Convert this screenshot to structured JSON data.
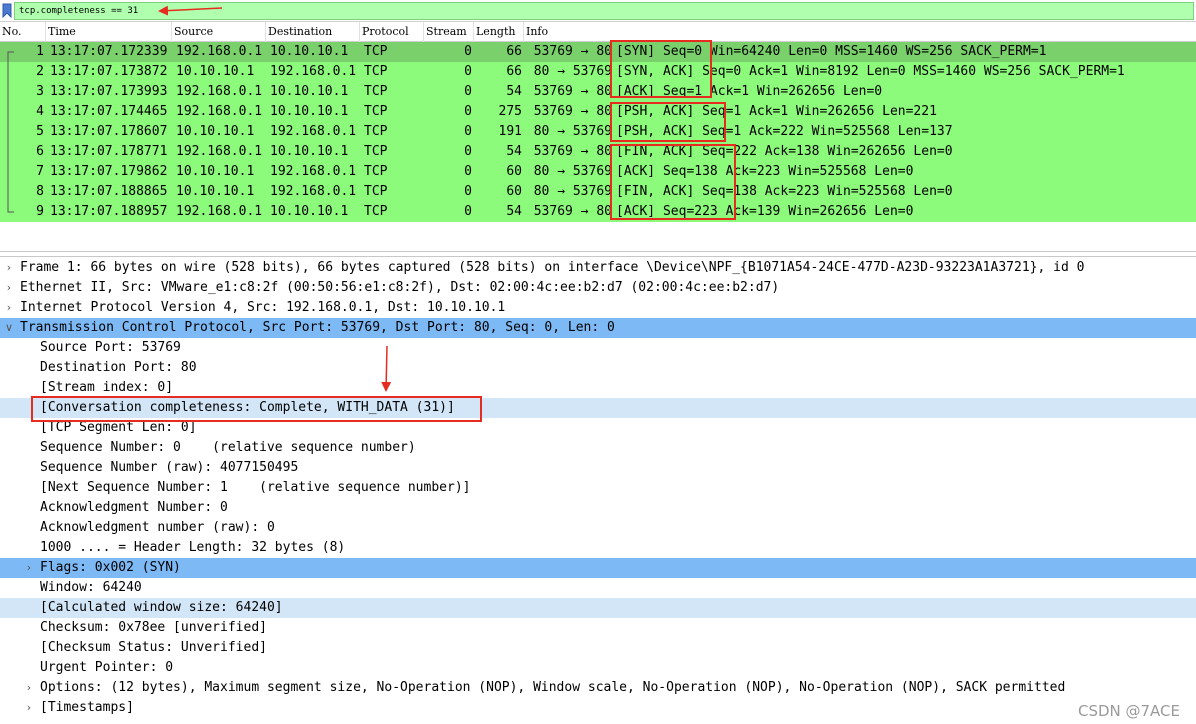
{
  "filter": {
    "value": "tcp.completeness == 31"
  },
  "columns": [
    "No.",
    "Time",
    "Source",
    "Destination",
    "Protocol",
    "Stream",
    "Length",
    "Info"
  ],
  "packets": [
    {
      "no": "1",
      "time": "13:17:07.172339",
      "src": "192.168.0.1",
      "dst": "10.10.10.1",
      "proto": "TCP",
      "stream": "0",
      "len": "66",
      "ports": "53769 → 80",
      "flags": "[SYN]",
      "info": "Seq=0 Win=64240 Len=0 MSS=1460 WS=256 SACK_PERM=1"
    },
    {
      "no": "2",
      "time": "13:17:07.173872",
      "src": "10.10.10.1",
      "dst": "192.168.0.1",
      "proto": "TCP",
      "stream": "0",
      "len": "66",
      "ports": "80 → 53769",
      "flags": "[SYN, ACK]",
      "info": "Seq=0 Ack=1 Win=8192 Len=0 MSS=1460 WS=256 SACK_PERM=1"
    },
    {
      "no": "3",
      "time": "13:17:07.173993",
      "src": "192.168.0.1",
      "dst": "10.10.10.1",
      "proto": "TCP",
      "stream": "0",
      "len": "54",
      "ports": "53769 → 80",
      "flags": "[ACK]",
      "info": "Seq=1 Ack=1 Win=262656 Len=0"
    },
    {
      "no": "4",
      "time": "13:17:07.174465",
      "src": "192.168.0.1",
      "dst": "10.10.10.1",
      "proto": "TCP",
      "stream": "0",
      "len": "275",
      "ports": "53769 → 80",
      "flags": "[PSH, ACK]",
      "info": "Seq=1 Ack=1 Win=262656 Len=221"
    },
    {
      "no": "5",
      "time": "13:17:07.178607",
      "src": "10.10.10.1",
      "dst": "192.168.0.1",
      "proto": "TCP",
      "stream": "0",
      "len": "191",
      "ports": "80 → 53769",
      "flags": "[PSH, ACK]",
      "info": "Seq=1 Ack=222 Win=525568 Len=137"
    },
    {
      "no": "6",
      "time": "13:17:07.178771",
      "src": "192.168.0.1",
      "dst": "10.10.10.1",
      "proto": "TCP",
      "stream": "0",
      "len": "54",
      "ports": "53769 → 80",
      "flags": "[FIN, ACK]",
      "info": "Seq=222 Ack=138 Win=262656 Len=0"
    },
    {
      "no": "7",
      "time": "13:17:07.179862",
      "src": "10.10.10.1",
      "dst": "192.168.0.1",
      "proto": "TCP",
      "stream": "0",
      "len": "60",
      "ports": "80 → 53769",
      "flags": "[ACK]",
      "info": "Seq=138 Ack=223 Win=525568 Len=0"
    },
    {
      "no": "8",
      "time": "13:17:07.188865",
      "src": "10.10.10.1",
      "dst": "192.168.0.1",
      "proto": "TCP",
      "stream": "0",
      "len": "60",
      "ports": "80 → 53769",
      "flags": "[FIN, ACK]",
      "info": "Seq=138 Ack=223 Win=525568 Len=0"
    },
    {
      "no": "9",
      "time": "13:17:07.188957",
      "src": "192.168.0.1",
      "dst": "10.10.10.1",
      "proto": "TCP",
      "stream": "0",
      "len": "54",
      "ports": "53769 → 80",
      "flags": "[ACK]",
      "info": "Seq=223 Ack=139 Win=262656 Len=0"
    }
  ],
  "details": [
    {
      "text": "Frame 1: 66 bytes on wire (528 bits), 66 bytes captured (528 bits) on interface \\Device\\NPF_{B1071A54-24CE-477D-A23D-93223A1A3721}, id 0",
      "indent": 0,
      "expander": "collapsed",
      "hl": ""
    },
    {
      "text": "Ethernet II, Src: VMware_e1:c8:2f (00:50:56:e1:c8:2f), Dst: 02:00:4c:ee:b2:d7 (02:00:4c:ee:b2:d7)",
      "indent": 0,
      "expander": "collapsed",
      "hl": ""
    },
    {
      "text": "Internet Protocol Version 4, Src: 192.168.0.1, Dst: 10.10.10.1",
      "indent": 0,
      "expander": "collapsed",
      "hl": ""
    },
    {
      "text": "Transmission Control Protocol, Src Port: 53769, Dst Port: 80, Seq: 0, Len: 0",
      "indent": 0,
      "expander": "expanded",
      "hl": "blue"
    },
    {
      "text": "Source Port: 53769",
      "indent": 1,
      "expander": "none",
      "hl": ""
    },
    {
      "text": "Destination Port: 80",
      "indent": 1,
      "expander": "none",
      "hl": ""
    },
    {
      "text": "[Stream index: 0]",
      "indent": 1,
      "expander": "none",
      "hl": ""
    },
    {
      "text": "[Conversation completeness: Complete, WITH_DATA (31)]",
      "indent": 1,
      "expander": "none",
      "hl": "light"
    },
    {
      "text": "[TCP Segment Len: 0]",
      "indent": 1,
      "expander": "none",
      "hl": ""
    },
    {
      "text": "Sequence Number: 0    (relative sequence number)",
      "indent": 1,
      "expander": "none",
      "hl": ""
    },
    {
      "text": "Sequence Number (raw): 4077150495",
      "indent": 1,
      "expander": "none",
      "hl": ""
    },
    {
      "text": "[Next Sequence Number: 1    (relative sequence number)]",
      "indent": 1,
      "expander": "none",
      "hl": ""
    },
    {
      "text": "Acknowledgment Number: 0",
      "indent": 1,
      "expander": "none",
      "hl": ""
    },
    {
      "text": "Acknowledgment number (raw): 0",
      "indent": 1,
      "expander": "none",
      "hl": ""
    },
    {
      "text": "1000 .... = Header Length: 32 bytes (8)",
      "indent": 1,
      "expander": "none",
      "hl": ""
    },
    {
      "text": "Flags: 0x002 (SYN)",
      "indent": 1,
      "expander": "collapsed",
      "hl": "blue"
    },
    {
      "text": "Window: 64240",
      "indent": 1,
      "expander": "none",
      "hl": ""
    },
    {
      "text": "[Calculated window size: 64240]",
      "indent": 1,
      "expander": "none",
      "hl": "light"
    },
    {
      "text": "Checksum: 0x78ee [unverified]",
      "indent": 1,
      "expander": "none",
      "hl": ""
    },
    {
      "text": "[Checksum Status: Unverified]",
      "indent": 1,
      "expander": "none",
      "hl": ""
    },
    {
      "text": "Urgent Pointer: 0",
      "indent": 1,
      "expander": "none",
      "hl": ""
    },
    {
      "text": "Options: (12 bytes), Maximum segment size, No-Operation (NOP), Window scale, No-Operation (NOP), No-Operation (NOP), SACK permitted",
      "indent": 1,
      "expander": "collapsed",
      "hl": ""
    },
    {
      "text": "[Timestamps]",
      "indent": 1,
      "expander": "collapsed",
      "hl": ""
    }
  ],
  "watermark": "CSDN @7ACE",
  "colors": {
    "row_bg": "#8cfa7a",
    "selected_bg": "#7ad16c",
    "filter_bg": "#afffaf",
    "highlight_blue": "#7db9f5",
    "highlight_light": "#d2e6f8",
    "annotation_red": "#e52c1f"
  },
  "icons": {
    "bookmark": "bookmark-icon",
    "expand": "chevron-down-icon",
    "collapse": "chevron-right-icon"
  }
}
